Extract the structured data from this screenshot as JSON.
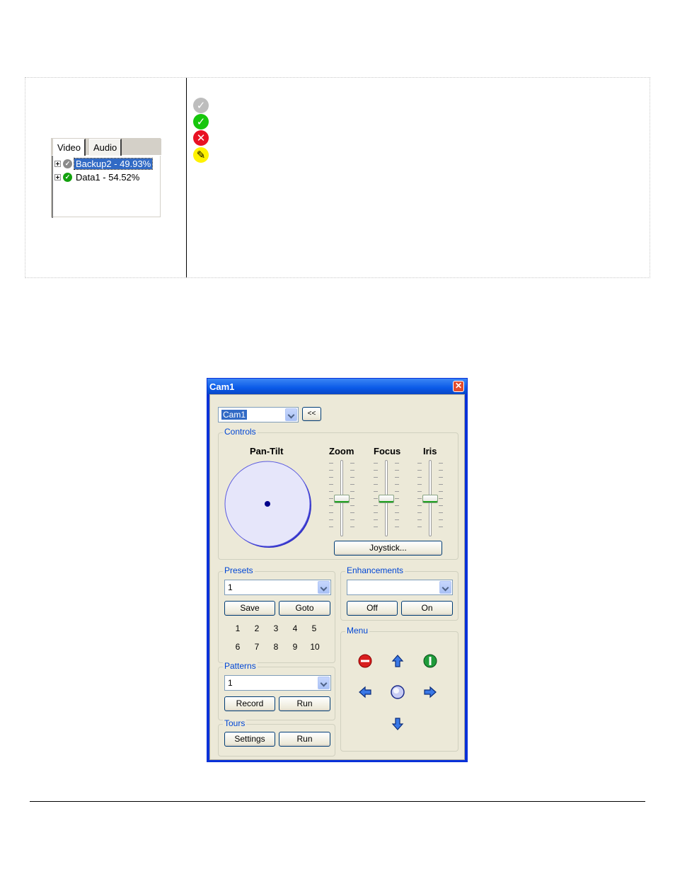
{
  "tree": {
    "tabs": [
      "Video",
      "Audio"
    ],
    "items": [
      {
        "label": "Backup2 - 49.93%",
        "status": "gray-check",
        "selected": true
      },
      {
        "label": "Data1 - 54.52%",
        "status": "green-check",
        "selected": false
      }
    ]
  },
  "legend_icons": [
    {
      "icon": "gray-check-icon",
      "color": "#b9b9b9",
      "glyph": "✓"
    },
    {
      "icon": "green-check-icon",
      "color": "#16c60c",
      "glyph": "✓"
    },
    {
      "icon": "red-x-icon",
      "color": "#e81123",
      "glyph": "✕"
    },
    {
      "icon": "yellow-pencil-icon",
      "color": "#fff200",
      "glyph": "✎"
    }
  ],
  "cam_window": {
    "title": "Cam1",
    "camera_select": {
      "value": "Cam1"
    },
    "collapse_label": "<<",
    "controls": {
      "title": "Controls",
      "pan_tilt_label": "Pan-Tilt",
      "zoom_label": "Zoom",
      "focus_label": "Focus",
      "iris_label": "Iris",
      "joystick_label": "Joystick..."
    },
    "presets": {
      "title": "Presets",
      "value": "1",
      "save_label": "Save",
      "goto_label": "Goto",
      "numbers": [
        "1",
        "2",
        "3",
        "4",
        "5",
        "6",
        "7",
        "8",
        "9",
        "10"
      ]
    },
    "patterns": {
      "title": "Patterns",
      "value": "1",
      "record_label": "Record",
      "run_label": "Run"
    },
    "tours": {
      "title": "Tours",
      "settings_label": "Settings",
      "run_label": "Run"
    },
    "enhancements": {
      "title": "Enhancements",
      "value": "",
      "off_label": "Off",
      "on_label": "On"
    },
    "menu": {
      "title": "Menu",
      "icons": [
        "stop-icon",
        "arrow-up-icon",
        "power-icon",
        "arrow-left-icon",
        "center-icon",
        "arrow-right-icon",
        "arrow-down-icon"
      ]
    }
  }
}
